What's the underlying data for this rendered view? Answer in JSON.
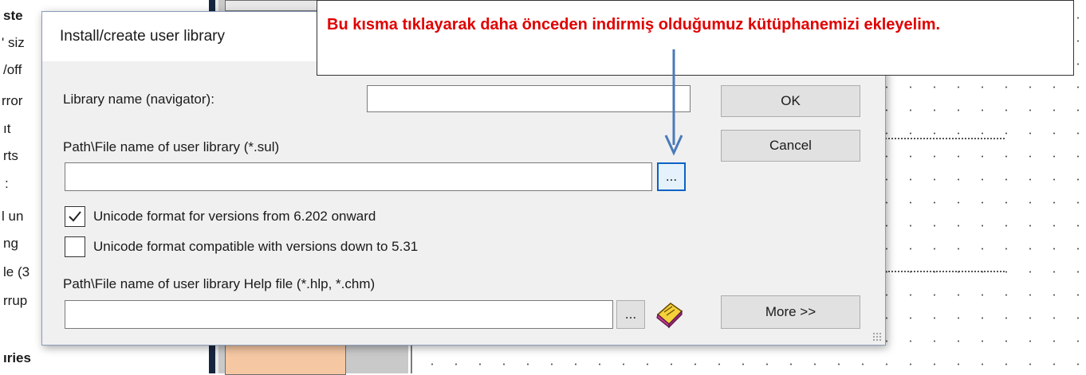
{
  "background": {
    "left_items": [
      {
        "text": "ste",
        "bold": true
      },
      {
        "text": "' siz"
      },
      {
        "text": "/off"
      },
      {
        "text": "rror"
      },
      {
        "text": "ıt"
      },
      {
        "text": "rts"
      },
      {
        "text": ":"
      },
      {
        "text": "l un",
        "blue_prefix": true
      },
      {
        "text": "ng"
      },
      {
        "text": "le (3"
      },
      {
        "text": "rrup"
      },
      {
        "text": "ıries",
        "bold": true
      }
    ]
  },
  "dialog": {
    "title": "Install/create user library",
    "library_name_label": "Library name (navigator):",
    "library_name_value": "",
    "path_label": "Path\\File name of user library (*.sul)",
    "path_value": "",
    "browse_label": "...",
    "unicode_new_label": "Unicode format for versions from 6.202 onward",
    "unicode_new_checked": true,
    "unicode_old_label": "Unicode format compatible with versions down to 5.31",
    "unicode_old_checked": false,
    "help_path_label": "Path\\File name of user library Help file (*.hlp, *.chm)",
    "help_path_value": "",
    "help_browse_label": "...",
    "ok_label": "OK",
    "cancel_label": "Cancel",
    "more_label": "More >>"
  },
  "annotation": {
    "text": "Bu kısma tıklayarak daha önceden indirmiş olduğumuz kütüphanemizi ekleyelim.",
    "color": "#e00000",
    "arrow_color": "#4a7ab8"
  },
  "icons": {
    "help_book": "help-book-icon",
    "checkmark": "checkmark-icon",
    "resize_grip": "resize-grip-icon"
  }
}
